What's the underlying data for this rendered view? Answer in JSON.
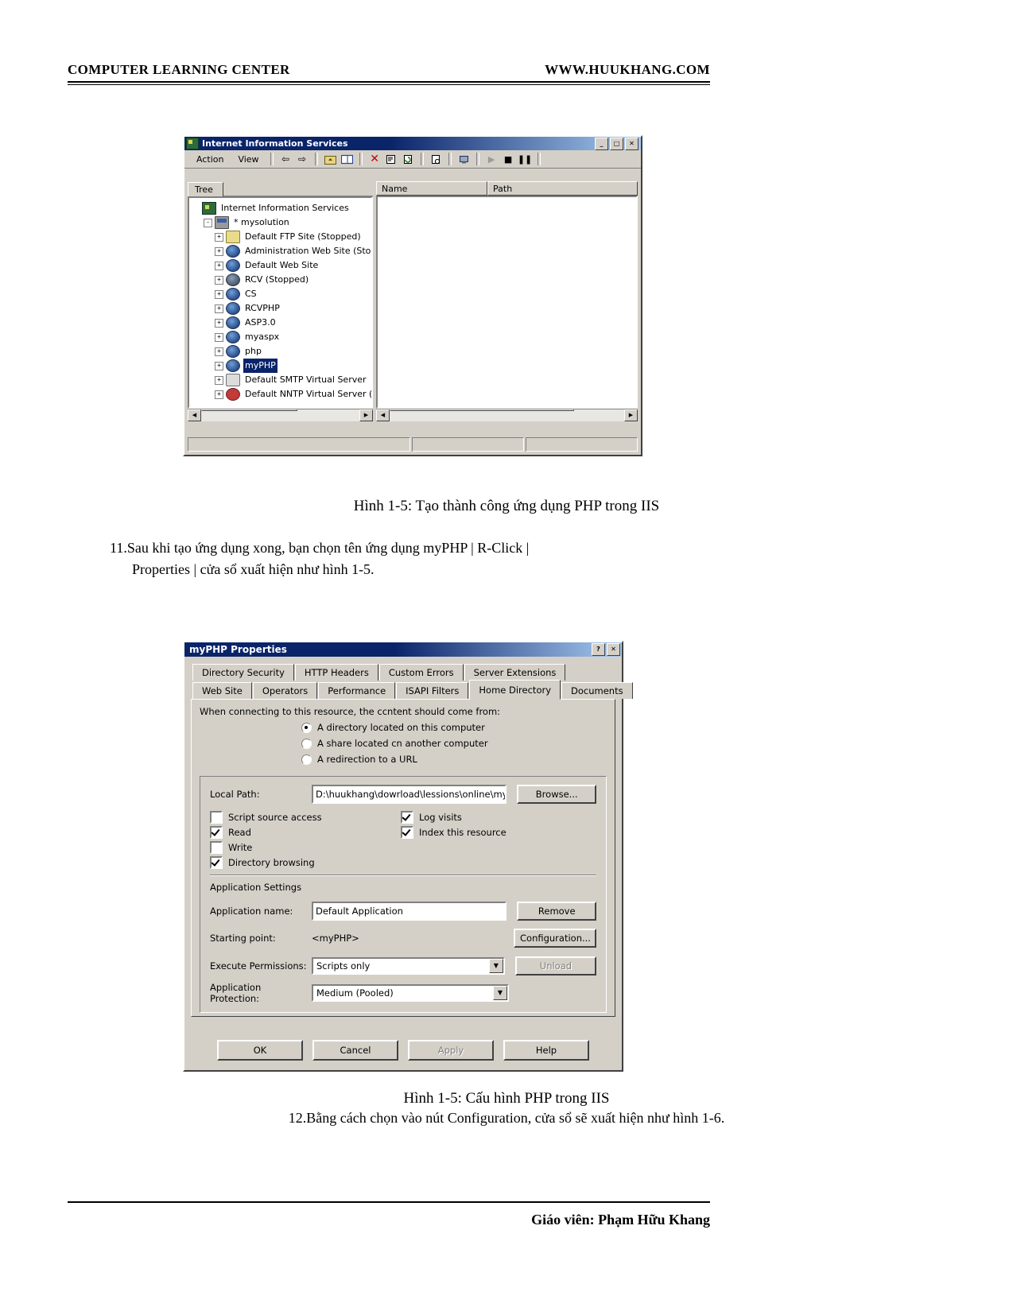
{
  "page_header": {
    "left": "COMPUTER LEARNING CENTER",
    "right": "WWW.HUUKHANG.COM"
  },
  "iis_window": {
    "title": "Internet Information Services",
    "icon": "iis-icon",
    "window_buttons": {
      "minimize": "_",
      "maximize": "□",
      "close": "✕"
    },
    "menu": [
      {
        "label": "Action"
      },
      {
        "label": "View"
      }
    ],
    "toolbar_icons": [
      "back-arrow-icon",
      "forward-arrow-icon",
      "up-folder-icon",
      "show-pane-icon",
      "delete-icon",
      "properties-icon",
      "refresh-icon",
      "export-list-icon",
      "connect-computer-icon",
      "start-icon",
      "stop-icon",
      "pause-icon"
    ],
    "tree_tab_label": "Tree",
    "list_columns": [
      "Name",
      "Path"
    ],
    "tree": [
      {
        "label": "Internet Information Services",
        "icon": "iis-icon",
        "expander": "",
        "indent": 0,
        "selected": false
      },
      {
        "label": "* mysolution",
        "icon": "server-icon",
        "expander": "-",
        "indent": 1,
        "selected": false
      },
      {
        "label": "Default FTP Site (Stopped)",
        "icon": "ftp-site-icon",
        "expander": "+",
        "indent": 2,
        "selected": false
      },
      {
        "label": "Administration Web Site (Sto",
        "icon": "web-site-icon",
        "expander": "+",
        "indent": 2,
        "selected": false
      },
      {
        "label": "Default Web Site",
        "icon": "web-site-icon",
        "expander": "+",
        "indent": 2,
        "selected": false
      },
      {
        "label": "RCV (Stopped)",
        "icon": "web-site-stopped-icon",
        "expander": "+",
        "indent": 2,
        "selected": false
      },
      {
        "label": "CS",
        "icon": "web-site-icon",
        "expander": "+",
        "indent": 2,
        "selected": false
      },
      {
        "label": "RCVPHP",
        "icon": "web-site-icon",
        "expander": "+",
        "indent": 2,
        "selected": false
      },
      {
        "label": "ASP3.0",
        "icon": "web-site-icon",
        "expander": "+",
        "indent": 2,
        "selected": false
      },
      {
        "label": "myaspx",
        "icon": "web-site-icon",
        "expander": "+",
        "indent": 2,
        "selected": false
      },
      {
        "label": "php",
        "icon": "web-site-icon",
        "expander": "+",
        "indent": 2,
        "selected": false
      },
      {
        "label": "myPHP",
        "icon": "web-site-icon",
        "expander": "+",
        "indent": 2,
        "selected": true
      },
      {
        "label": "Default SMTP Virtual Server",
        "icon": "smtp-icon",
        "expander": "+",
        "indent": 2,
        "selected": false
      },
      {
        "label": "Default NNTP Virtual Server (",
        "icon": "nntp-icon",
        "expander": "+",
        "indent": 2,
        "selected": false
      }
    ]
  },
  "caption_1": "Hình 1-5: Tạo thành công ứng dụng PHP trong IIS",
  "step_11": {
    "line1": "11.Sau khi tạo ứng dụng xong, bạn chọn tên ứng dụng myPHP | R-Click |",
    "line2": "Properties | cửa sổ xuất hiện như hình 1-5."
  },
  "props_dialog": {
    "title": "myPHP Properties",
    "title_buttons": {
      "help": "?",
      "close": "✕"
    },
    "tabs_row1": [
      {
        "label": "Directory Security",
        "active": false
      },
      {
        "label": "HTTP Headers",
        "active": false
      },
      {
        "label": "Custom Errors",
        "active": false
      },
      {
        "label": "Server Extensions",
        "active": false
      }
    ],
    "tabs_row2": [
      {
        "label": "Web Site",
        "active": false
      },
      {
        "label": "Operators",
        "active": false
      },
      {
        "label": "Performance",
        "active": false
      },
      {
        "label": "ISAPI Filters",
        "active": false
      },
      {
        "label": "Home Directory",
        "active": true
      },
      {
        "label": "Documents",
        "active": false
      }
    ],
    "prompt": "When connecting to this resource, the ccntent should come from:",
    "radios": [
      {
        "label": "A directory located on this computer",
        "checked": true
      },
      {
        "label": "A share located cn another computer",
        "checked": false
      },
      {
        "label": "A redirection to a URL",
        "checked": false
      }
    ],
    "local_path_label": "Local Path:",
    "local_path_value": "D:\\huukhang\\dowrload\\lessions\\online\\my",
    "browse_label": "Browse...",
    "checkboxes_left": [
      {
        "label": "Script source access",
        "checked": false
      },
      {
        "label": "Read",
        "checked": true
      },
      {
        "label": "Write",
        "checked": false
      },
      {
        "label": "Directory browsing",
        "checked": true
      }
    ],
    "checkboxes_right": [
      {
        "label": "Log visits",
        "checked": true
      },
      {
        "label": "Index this resource",
        "checked": true
      }
    ],
    "app_settings_label": "Application Settings",
    "app_name_label": "Application name:",
    "app_name_value": "Default Application",
    "remove_label": "Remove",
    "starting_point_label": "Starting point:",
    "starting_point_value": "<myPHP>",
    "configuration_label": "Configuration...",
    "exec_perm_label": "Execute Permissions:",
    "exec_perm_value": "Scripts only",
    "app_protection_label": "Application Protection:",
    "app_protection_value": "Medium (Pooled)",
    "unload_label": "Unload",
    "buttons": [
      {
        "label": "OK",
        "disabled": false
      },
      {
        "label": "Cancel",
        "disabled": false
      },
      {
        "label": "Apply",
        "disabled": true
      },
      {
        "label": "Help",
        "disabled": false
      }
    ]
  },
  "caption_2": "Hình 1-5: Cấu hình PHP trong IIS",
  "step_12": "12.Bằng cách chọn vào nút Configuration, cửa sổ sẽ xuất hiện như hình 1-6.",
  "footer": "Giáo viên: Phạm Hữu Khang"
}
